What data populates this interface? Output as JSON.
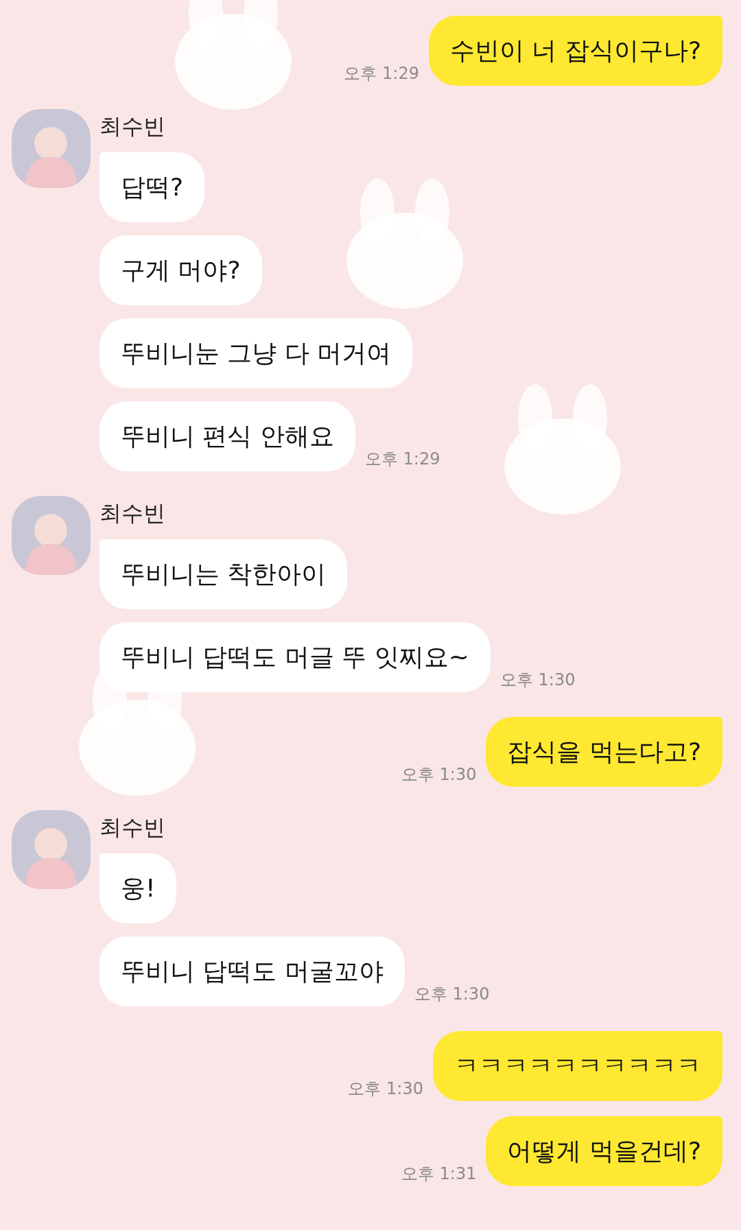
{
  "chat": [
    {
      "kind": "sent",
      "messages": [
        {
          "text": "수빈이 너 잡식이구나?"
        }
      ],
      "time": "오후 1:29"
    },
    {
      "kind": "received",
      "name": "최수빈",
      "messages": [
        {
          "text": "답떡?"
        },
        {
          "text": "구게 머야?"
        },
        {
          "text": "뚜비니눈 그냥 다 머거여"
        },
        {
          "text": "뚜비니 편식 안해요"
        }
      ],
      "time": "오후 1:29"
    },
    {
      "kind": "received",
      "name": "최수빈",
      "messages": [
        {
          "text": "뚜비니는 착한아이"
        },
        {
          "text": "뚜비니 답떡도 머글 뚜 잇찌요~"
        }
      ],
      "time": "오후 1:30"
    },
    {
      "kind": "sent",
      "messages": [
        {
          "text": "잡식을 먹는다고?"
        }
      ],
      "time": "오후 1:30"
    },
    {
      "kind": "received",
      "name": "최수빈",
      "messages": [
        {
          "text": "웅!"
        },
        {
          "text": "뚜비니 답떡도 머굴꼬야"
        }
      ],
      "time": "오후 1:30"
    },
    {
      "kind": "sent",
      "messages": [
        {
          "text": "ㅋㅋㅋㅋㅋㅋㅋㅋㅋㅋ"
        }
      ],
      "time": "오후 1:30"
    },
    {
      "kind": "sent",
      "messages": [
        {
          "text": "어떻게 먹을건데?"
        }
      ],
      "time": "오후 1:31"
    }
  ]
}
